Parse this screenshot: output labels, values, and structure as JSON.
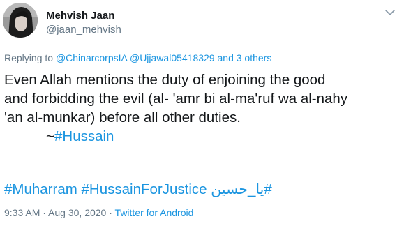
{
  "author": {
    "name": "Mehvish Jaan",
    "handle": "@jaan_mehvish"
  },
  "reply": {
    "prefix": "Replying to",
    "user1": "@ChinarcorpsIA",
    "user2": "@Ujjawal05418329",
    "and_others": "and 3 others"
  },
  "text": {
    "line1": "Even Allah mentions the duty of enjoining the good",
    "line2": "and forbidding the evil (al- 'amr bi al-ma'ruf wa al-nahy",
    "line3": "'an al-munkar) before all other duties.",
    "line4_prefix": "~",
    "line4_hashtag": "#Hussain"
  },
  "hashtags": {
    "tag1": "#Muharram",
    "tag2": "#HussainForJustice",
    "tag3": "#يا_حسين"
  },
  "meta": {
    "time": "9:33 AM",
    "sep1": " · ",
    "date": "Aug 30, 2020",
    "sep2": " · ",
    "source": "Twitter for Android"
  },
  "icons": {
    "avatar": "profile-photo",
    "caret": "chevron-down-icon"
  },
  "colors": {
    "link": "#1b95e0",
    "secondary_text": "#657786",
    "primary_text": "#14171a"
  }
}
